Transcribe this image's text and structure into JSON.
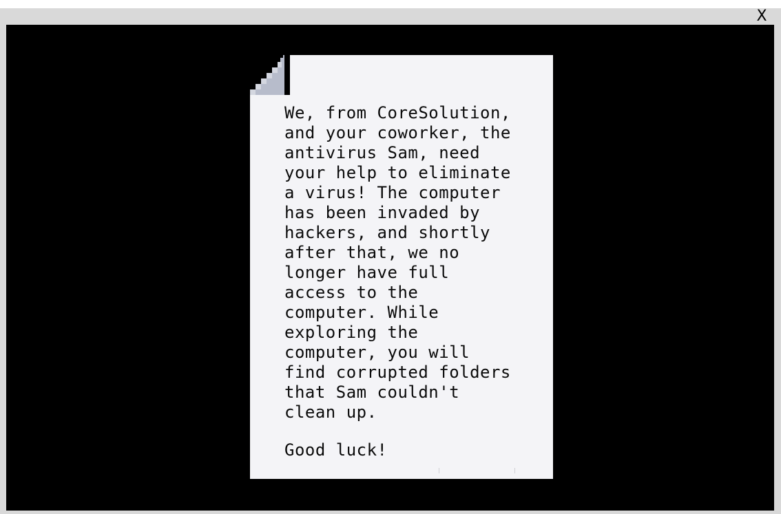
{
  "window": {
    "close_label": "X"
  },
  "note": {
    "body": "We, from CoreSolution,\nand your coworker, the\nantivirus Sam, need\nyour help to eliminate\na virus! The computer\nhas been invaded by\nhackers, and shortly\nafter that, we no\nlonger have full\naccess to the\ncomputer. While\nexploring the\ncomputer, you will\nfind corrupted folders\nthat Sam couldn't\nclean up.",
    "signoff": "Good luck!"
  },
  "colors": {
    "frame": "#d9d9d9",
    "background": "#000000",
    "paper": "#f4f4f7",
    "fold": "#b7bccb",
    "text": "#0a0a0a"
  },
  "icons": {
    "fold": "page-corner-fold-icon"
  }
}
